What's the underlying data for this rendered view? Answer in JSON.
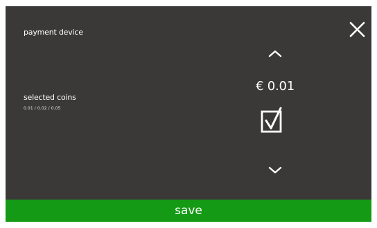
{
  "header": {
    "title": "payment device",
    "close_icon": "close-icon"
  },
  "setting": {
    "label": "selected coins",
    "selected_coins": "0.01 / 0.02 / 0.05",
    "current_value": "€ 0.01",
    "checked": true,
    "up_icon": "chevron-up-icon",
    "down_icon": "chevron-down-icon"
  },
  "footer": {
    "save_label": "save"
  },
  "colors": {
    "panel_background": "#3b3937",
    "save_button": "#149a14",
    "text": "#ffffff"
  }
}
